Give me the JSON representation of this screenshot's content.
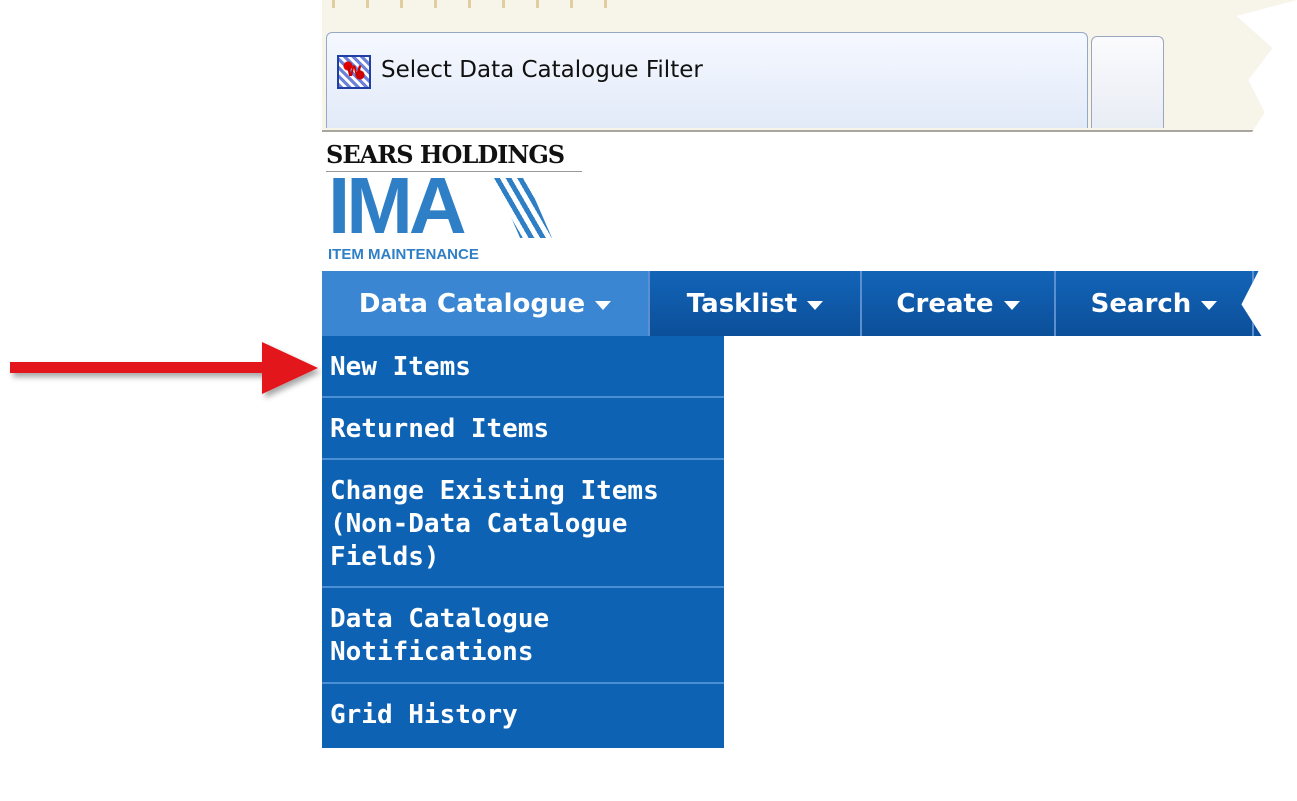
{
  "browser": {
    "tab_title": "Select Data Catalogue Filter",
    "favicon_glyph": "W"
  },
  "logo": {
    "company": "SEARS HOLDINGS",
    "mark": "IMA",
    "subtitle": "ITEM MAINTENANCE"
  },
  "nav": {
    "items": [
      {
        "label": "Data Catalogue",
        "active": true
      },
      {
        "label": "Tasklist",
        "active": false
      },
      {
        "label": "Create",
        "active": false
      },
      {
        "label": "Search",
        "active": false
      }
    ]
  },
  "dropdown": {
    "items": [
      {
        "label": "New Items"
      },
      {
        "label": "Returned Items"
      },
      {
        "label": "Change Existing Items\n(Non-Data Catalogue\nFields)"
      },
      {
        "label": "Data Catalogue\nNotifications"
      },
      {
        "label": "Grid History"
      }
    ]
  },
  "annotation": {
    "arrow_color": "#e3121b",
    "target": "New Items"
  },
  "colors": {
    "nav_blue": "#0c4f99",
    "active_blue": "#3a86d2",
    "dropdown_blue": "#0e62b3",
    "logo_blue": "#2f7fc6"
  }
}
